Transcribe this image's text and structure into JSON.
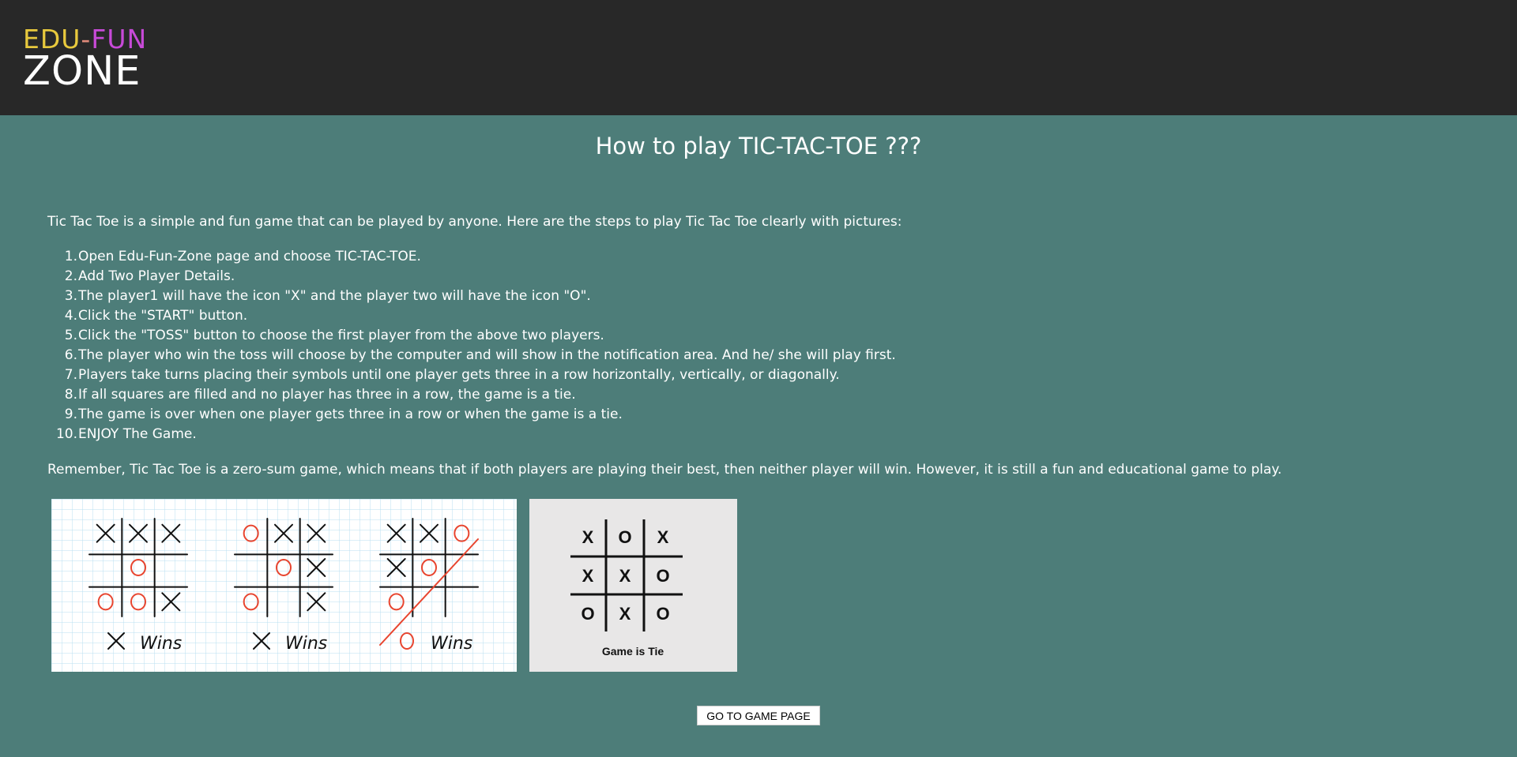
{
  "logo": {
    "line1_edu": "EDU",
    "line1_dash": "-",
    "line1_fun": "FUN",
    "line2": "ZONE"
  },
  "page_title": "How to play TIC-TAC-TOE ???",
  "intro": "Tic Tac Toe is a simple and fun game that can be played by anyone. Here are the steps to play Tic Tac Toe clearly with pictures:",
  "steps": [
    {
      "num": "1.",
      "text": "Open Edu-Fun-Zone page and choose TIC-TAC-TOE."
    },
    {
      "num": "2.",
      "text": "Add Two Player Details."
    },
    {
      "num": "3.",
      "text": "The player1 will have the icon \"X\" and the player two will have the icon \"O\"."
    },
    {
      "num": "4.",
      "text": "Click the \"START\" button."
    },
    {
      "num": "5.",
      "text": "Click the \"TOSS\" button to choose the first player from the above two players."
    },
    {
      "num": "6.",
      "text": "The player who win the toss will choose by the computer and will show in the notification area. And he/ she will play first."
    },
    {
      "num": "7.",
      "text": "Players take turns placing their symbols until one player gets three in a row horizontally, vertically, or diagonally."
    },
    {
      "num": "8.",
      "text": "If all squares are filled and no player has three in a row, the game is a tie."
    },
    {
      "num": "9.",
      "text": "The game is over when one player gets three in a row or when the game is a tie."
    },
    {
      "num": "10.",
      "text": "ENJOY The Game."
    }
  ],
  "remember": "Remember, Tic Tac Toe is a zero-sum game, which means that if both players are playing their best, then neither player will win. However, it is still a fun and educational game to play.",
  "wins_image": {
    "captions": [
      "Wins",
      "Wins",
      "Wins"
    ]
  },
  "tie_image": {
    "cells": [
      "X",
      "O",
      "X",
      "X",
      "X",
      "O",
      "O",
      "X",
      "O"
    ],
    "caption": "Game is Tie"
  },
  "go_button": "GO TO GAME PAGE",
  "colors": {
    "background": "#4d7d79",
    "header": "#282828",
    "o_mark": "#e8452f",
    "edu": "#e8c93d",
    "fun": "#c84ad8"
  }
}
